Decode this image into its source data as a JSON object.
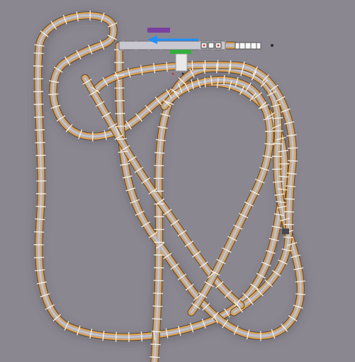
{
  "scene": {
    "name": "roller-coaster-track-top-view",
    "background_color": "#ffffff",
    "ground_color": "#8a8790",
    "rail_color": "#e0a14a",
    "rail_shadow_color": "#5b4a3a",
    "deck_color": "#b4b2bb",
    "tie_color": "#f4f2ea",
    "station": {
      "arrow_color": "#1e90ff",
      "marker_purple": "#7b3fa0",
      "marker_green": "#2fb13a",
      "platform_color": "#e8e8e8"
    }
  }
}
